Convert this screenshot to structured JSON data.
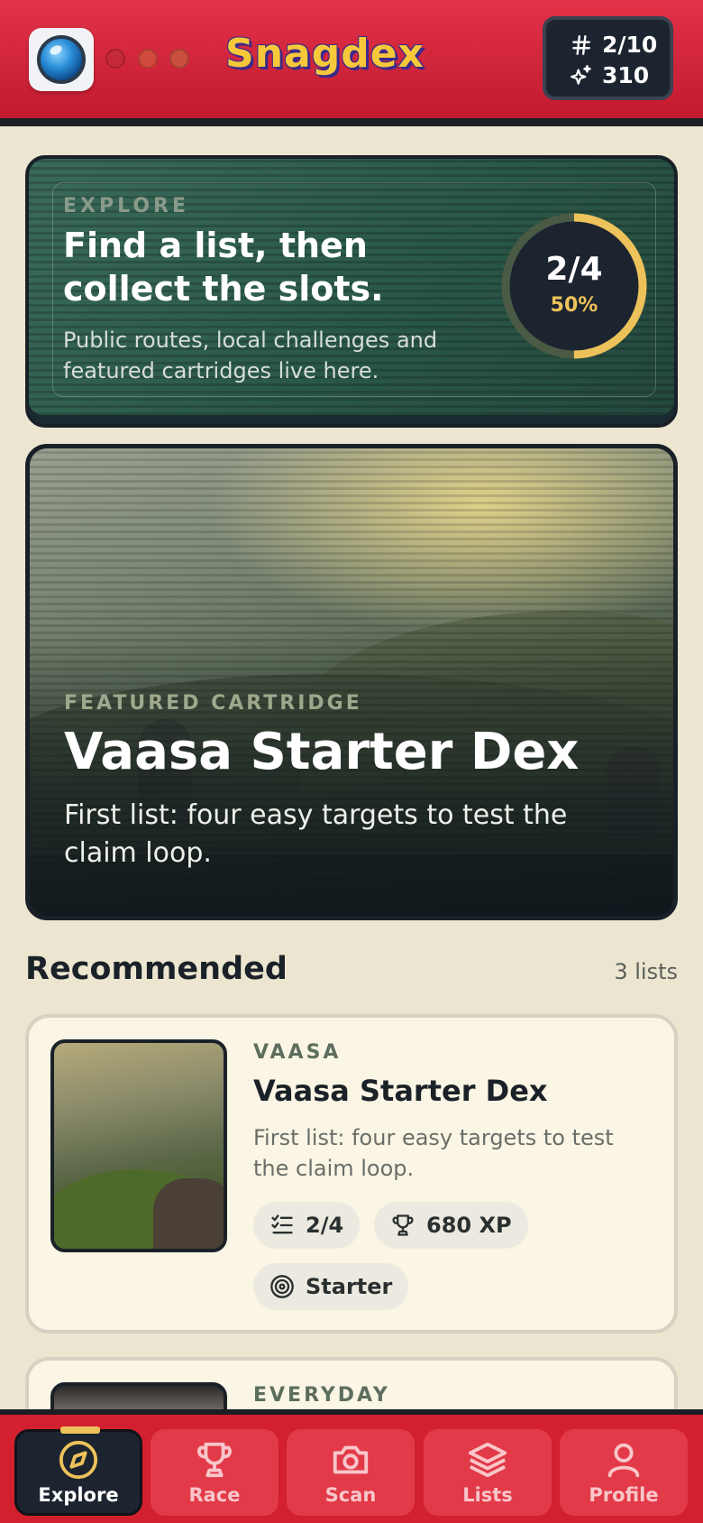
{
  "header": {
    "brand": "Snagdex",
    "stats": {
      "slots": "2/10",
      "xp": "310"
    }
  },
  "explore": {
    "eyebrow": "EXPLORE",
    "title": "Find a list, then collect the slots.",
    "subtitle": "Public routes, local challenges and featured cartridges live here.",
    "progress": {
      "count": "2/4",
      "percent": "50%",
      "fraction": 0.5
    }
  },
  "featured": {
    "eyebrow": "FEATURED CARTRIDGE",
    "title": "Vaasa Starter Dex",
    "subtitle": "First list: four easy targets to test the claim loop."
  },
  "recommended": {
    "title": "Recommended",
    "count": "3 lists",
    "items": [
      {
        "eyebrow": "VAASA",
        "title": "Vaasa Starter Dex",
        "subtitle": "First list: four easy targets to test the claim loop.",
        "progress": "2/4",
        "xp": "680 XP",
        "tag": "Starter"
      },
      {
        "eyebrow": "EVERYDAY"
      }
    ]
  },
  "nav": {
    "items": [
      {
        "label": "Explore",
        "icon": "compass-icon"
      },
      {
        "label": "Race",
        "icon": "trophy-icon"
      },
      {
        "label": "Scan",
        "icon": "camera-icon"
      },
      {
        "label": "Lists",
        "icon": "layers-icon"
      },
      {
        "label": "Profile",
        "icon": "user-icon"
      }
    ],
    "active": "Explore"
  },
  "colors": {
    "primary_red": "#d2202e",
    "accent_gold": "#eec25a",
    "dark": "#1c2430",
    "cream": "#faf5e4"
  }
}
